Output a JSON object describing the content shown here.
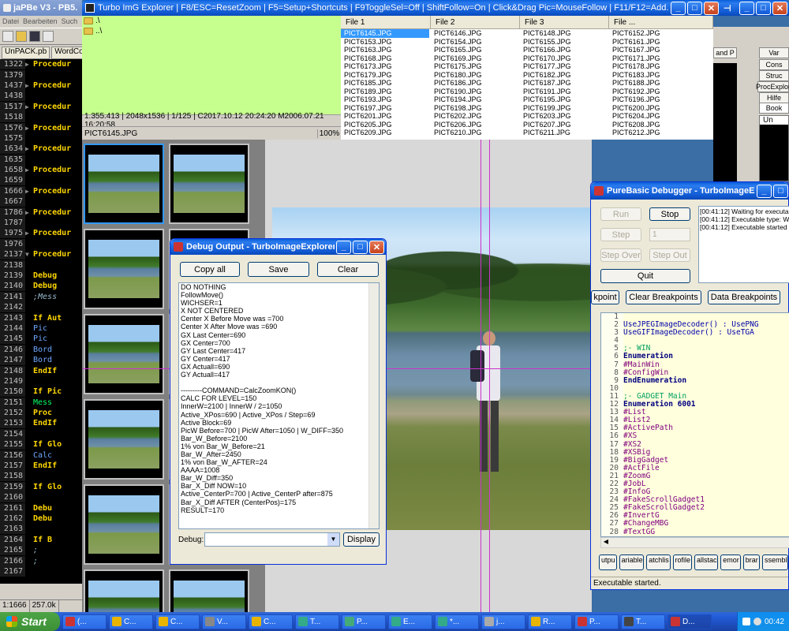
{
  "editor": {
    "title": "jaPBe V3 - PB5.",
    "menu": [
      "Datei",
      "Bearbeiten",
      "Such"
    ],
    "tabs": [
      "UnPACK.pb",
      "WordComb"
    ],
    "lines": [
      {
        "n": "1322",
        "t": "Procedur",
        "c": "kw",
        "fold": "▶"
      },
      {
        "n": "1379",
        "t": "",
        "c": "",
        "fold": ""
      },
      {
        "n": "1437",
        "t": "Procedur",
        "c": "kw",
        "fold": "▶"
      },
      {
        "n": "1438",
        "t": "",
        "c": "",
        "fold": ""
      },
      {
        "n": "1517",
        "t": "Procedur",
        "c": "kw",
        "fold": "▶"
      },
      {
        "n": "1518",
        "t": "",
        "c": "",
        "fold": ""
      },
      {
        "n": "1576",
        "t": "Procedur",
        "c": "kw",
        "fold": "▶"
      },
      {
        "n": "1575",
        "t": "",
        "c": "",
        "fold": ""
      },
      {
        "n": "1634",
        "t": "Procedur",
        "c": "kw",
        "fold": "▶"
      },
      {
        "n": "1635",
        "t": "",
        "c": "",
        "fold": ""
      },
      {
        "n": "1658",
        "t": "Procedur",
        "c": "kw",
        "fold": "▶"
      },
      {
        "n": "1659",
        "t": "",
        "c": "",
        "fold": ""
      },
      {
        "n": "1666",
        "t": "Procedur",
        "c": "kw",
        "fold": "▶"
      },
      {
        "n": "1667",
        "t": "",
        "c": "",
        "fold": ""
      },
      {
        "n": "1786",
        "t": "Procedur",
        "c": "kw",
        "fold": "▶"
      },
      {
        "n": "1787",
        "t": "",
        "c": "",
        "fold": ""
      },
      {
        "n": "1975",
        "t": "Procedur",
        "c": "kw",
        "fold": "▶"
      },
      {
        "n": "1976",
        "t": "",
        "c": "",
        "fold": ""
      },
      {
        "n": "2137",
        "t": "Procedur",
        "c": "kw",
        "fold": "▼"
      },
      {
        "n": "2138",
        "t": "",
        "c": "",
        "fold": ""
      },
      {
        "n": "2139",
        "t": "  Debug",
        "c": "kw",
        "fold": ""
      },
      {
        "n": "2140",
        "t": "  Debug",
        "c": "kw",
        "fold": ""
      },
      {
        "n": "2141",
        "t": "  ;Mess",
        "c": "cm",
        "fold": ""
      },
      {
        "n": "2142",
        "t": "",
        "c": "",
        "fold": ""
      },
      {
        "n": "2143",
        "t": "  If Aut",
        "c": "kw",
        "fold": ""
      },
      {
        "n": "2144",
        "t": "    Pic",
        "c": "bl",
        "fold": ""
      },
      {
        "n": "2145",
        "t": "    Pic",
        "c": "bl",
        "fold": ""
      },
      {
        "n": "2146",
        "t": "    Bord",
        "c": "bl",
        "fold": ""
      },
      {
        "n": "2147",
        "t": "    Bord",
        "c": "bl",
        "fold": ""
      },
      {
        "n": "2148",
        "t": "  EndIf",
        "c": "kw",
        "fold": ""
      },
      {
        "n": "2149",
        "t": "",
        "c": "",
        "fold": ""
      },
      {
        "n": "2150",
        "t": "  If Pic",
        "c": "kw",
        "fold": ""
      },
      {
        "n": "2151",
        "t": "    Mess",
        "c": "gr",
        "fold": ""
      },
      {
        "n": "2152",
        "t": "    Proc",
        "c": "kw",
        "fold": ""
      },
      {
        "n": "2153",
        "t": "  EndIf",
        "c": "kw",
        "fold": ""
      },
      {
        "n": "2154",
        "t": "",
        "c": "",
        "fold": ""
      },
      {
        "n": "2155",
        "t": "  If Glo",
        "c": "kw",
        "fold": ""
      },
      {
        "n": "2156",
        "t": "    Calc",
        "c": "bl",
        "fold": ""
      },
      {
        "n": "2157",
        "t": "  EndIf",
        "c": "kw",
        "fold": ""
      },
      {
        "n": "2158",
        "t": "",
        "c": "",
        "fold": ""
      },
      {
        "n": "2159",
        "t": "  If Glo",
        "c": "kw",
        "fold": ""
      },
      {
        "n": "2160",
        "t": "",
        "c": "",
        "fold": ""
      },
      {
        "n": "2161",
        "t": "    Debu",
        "c": "kw",
        "fold": ""
      },
      {
        "n": "2162",
        "t": "    Debu",
        "c": "kw",
        "fold": ""
      },
      {
        "n": "2163",
        "t": "",
        "c": "",
        "fold": ""
      },
      {
        "n": "2164",
        "t": "    If B",
        "c": "kw",
        "fold": ""
      },
      {
        "n": "2165",
        "t": "      ;",
        "c": "cm",
        "fold": ""
      },
      {
        "n": "2166",
        "t": "      ;",
        "c": "cm",
        "fold": ""
      },
      {
        "n": "2167",
        "t": "",
        "c": "",
        "fold": ""
      }
    ],
    "status_pos": "1:1666",
    "status_size": "257.0k"
  },
  "turbo": {
    "title": "Turbo ImG Explorer  |  F8/ESC=ResetZoom  |  F5=Setup+Shortcuts  |  F9ToggleSel=Off  |  ShiftFollow=On  |  Click&Drag Pic=MouseFollow  |  F11/F12=Add...",
    "dir_items": [
      ".\\",
      "..\\"
    ],
    "info_line": "1.355.413 | 2048x1536 | 1/125 | C2017.10.12  20:24:20  M2006.07.21  16:20:58",
    "current_file": "PICT6145.JPG",
    "zoom": "100%",
    "file_headers": [
      "File 1",
      "File 2",
      "File 3",
      "File ..."
    ],
    "files": [
      [
        "PICT6145.JPG",
        "PICT6146.JPG",
        "PICT6148.JPG",
        "PICT6152.JPG"
      ],
      [
        "PICT6153.JPG",
        "PICT6154.JPG",
        "PICT6155.JPG",
        "PICT6161.JPG"
      ],
      [
        "PICT6163.JPG",
        "PICT6165.JPG",
        "PICT6166.JPG",
        "PICT6167.JPG"
      ],
      [
        "PICT6168.JPG",
        "PICT6169.JPG",
        "PICT6170.JPG",
        "PICT6171.JPG"
      ],
      [
        "PICT6173.JPG",
        "PICT6175.JPG",
        "PICT6177.JPG",
        "PICT6178.JPG"
      ],
      [
        "PICT6179.JPG",
        "PICT6180.JPG",
        "PICT6182.JPG",
        "PICT6183.JPG"
      ],
      [
        "PICT6185.JPG",
        "PICT6186.JPG",
        "PICT6187.JPG",
        "PICT6188.JPG"
      ],
      [
        "PICT6189.JPG",
        "PICT6190.JPG",
        "PICT6191.JPG",
        "PICT6192.JPG"
      ],
      [
        "PICT6193.JPG",
        "PICT6194.JPG",
        "PICT6195.JPG",
        "PICT6196.JPG"
      ],
      [
        "PICT6197.JPG",
        "PICT6198.JPG",
        "PICT6199.JPG",
        "PICT6200.JPG"
      ],
      [
        "PICT6201.JPG",
        "PICT6202.JPG",
        "PICT6203.JPG",
        "PICT6204.JPG"
      ],
      [
        "PICT6205.JPG",
        "PICT6206.JPG",
        "PICT6207.JPG",
        "PICT6208.JPG"
      ],
      [
        "PICT6209.JPG",
        "PICT6210.JPG",
        "PICT6211.JPG",
        "PICT6212.JPG"
      ]
    ]
  },
  "debug_output": {
    "title": "Debug Output - TurboImageExplorer.pb",
    "copy_label": "Copy all",
    "save_label": "Save",
    "clear_label": "Clear",
    "debug_label": "Debug:",
    "display_label": "Display",
    "lines": [
      "DO NOTHING",
      "FollowMove()",
      "WICHSER=1",
      "X NOT CENTERED",
      "Center X Before Move was =700",
      "Center X After Move was =690",
      "GX Last Center=690",
      "GX Center=700",
      "GY Last Center=417",
      "GY Center=417",
      "GX Actuall=690",
      "GY Actuall=417",
      "",
      "---------COMMAND=CalcZoomKON()",
      "CALC FOR LEVEL=150",
      "InnerW=2100   |   InnerW / 2=1050",
      "Active_XPos=690   |   Active_XPos / Step=69",
      "Active Block=69",
      "PicW Before=700  |  PicW After=1050  |  W_DIFF=350",
      "Bar_W_Before=2100",
      "1% von Bar_W_Before=21",
      "Bar_W_After=2450",
      "1% von Bar_W_AFTER=24",
      "AAAA=1008",
      "Bar_W_Diff=350",
      "Bar_X_Diff NOW=10",
      "Active_CenterP=700 | Active_CenterP after=875",
      "Bar_X_Diff AFTER (CenterPos)=175",
      "RESULT=170"
    ]
  },
  "pb_debugger": {
    "title": "PureBasic Debugger - TurboImageExpl...",
    "run_label": "Run",
    "stop_label": "Stop",
    "step_label": "Step",
    "step_count": "1",
    "step_over_label": "Step Over",
    "step_out_label": "Step Out",
    "quit_label": "Quit",
    "bp_label": "kpoint",
    "clear_bp_label": "Clear Breakpoints",
    "data_bp_label": "Data Breakpoints",
    "log": [
      "[00:41:12] Waiting for executa",
      "[00:41:12] Executable type: W",
      "[00:41:12] Executable started"
    ],
    "code": [
      {
        "n": "1",
        "t": "",
        "c": ""
      },
      {
        "n": "2",
        "t": "UseJPEGImageDecoder() : UsePNG",
        "c": "pn"
      },
      {
        "n": "3",
        "t": "UseGIFImageDecoder() : UseTGA",
        "c": "pn"
      },
      {
        "n": "4",
        "t": "",
        "c": ""
      },
      {
        "n": "5",
        "t": ";- WIN",
        "c": "pg"
      },
      {
        "n": "6",
        "t": "Enumeration",
        "c": "pk"
      },
      {
        "n": "7",
        "t": "  #MainWin",
        "c": "pm"
      },
      {
        "n": "8",
        "t": "  #ConfigWin",
        "c": "pm"
      },
      {
        "n": "9",
        "t": "EndEnumeration",
        "c": "pk"
      },
      {
        "n": "10",
        "t": "",
        "c": ""
      },
      {
        "n": "11",
        "t": ";- GADGET Main",
        "c": "pg"
      },
      {
        "n": "12",
        "t": "Enumeration 6001",
        "c": "pk"
      },
      {
        "n": "13",
        "t": "  #List",
        "c": "pm"
      },
      {
        "n": "14",
        "t": "  #List2",
        "c": "pm"
      },
      {
        "n": "15",
        "t": "  #ActivePath",
        "c": "pm"
      },
      {
        "n": "16",
        "t": "  #XS",
        "c": "pm"
      },
      {
        "n": "17",
        "t": "  #XS2",
        "c": "pm"
      },
      {
        "n": "18",
        "t": "  #XSBig",
        "c": "pm"
      },
      {
        "n": "19",
        "t": "  #BigGadget",
        "c": "pm"
      },
      {
        "n": "20",
        "t": "  #ActFile",
        "c": "pm"
      },
      {
        "n": "21",
        "t": "  #ZoomG",
        "c": "pm"
      },
      {
        "n": "22",
        "t": "  #JobL",
        "c": "pm"
      },
      {
        "n": "23",
        "t": "  #InfoG",
        "c": "pm"
      },
      {
        "n": "24",
        "t": "  #FakeScrollGadget1",
        "c": "pm"
      },
      {
        "n": "25",
        "t": "  #FakeScrollGadget2",
        "c": "pm"
      },
      {
        "n": "26",
        "t": "  #InvertG",
        "c": "pm"
      },
      {
        "n": "27",
        "t": "  #ChangeMBG",
        "c": "pm"
      },
      {
        "n": "28",
        "t": "  #TextGG",
        "c": "pm"
      }
    ],
    "tabs": [
      "utpu",
      "ariable",
      "atchlis",
      "rofile",
      "allstac",
      "emor",
      "brar",
      "ssembl"
    ],
    "status": "Executable started."
  },
  "right_panel": {
    "items": [
      "Var",
      "Cons",
      "Struc",
      "ProcExplor",
      "Hilfe",
      "Book"
    ],
    "small_tab": "and P",
    "box_label": "Un"
  },
  "taskbar": {
    "start_label": "Start",
    "items": [
      "(...",
      "C...",
      "C...",
      "V...",
      "C...",
      "T...",
      "P...",
      "E...",
      "*...",
      "j...",
      "R...",
      "P...",
      "T...",
      "D..."
    ],
    "clock": "00:42"
  }
}
